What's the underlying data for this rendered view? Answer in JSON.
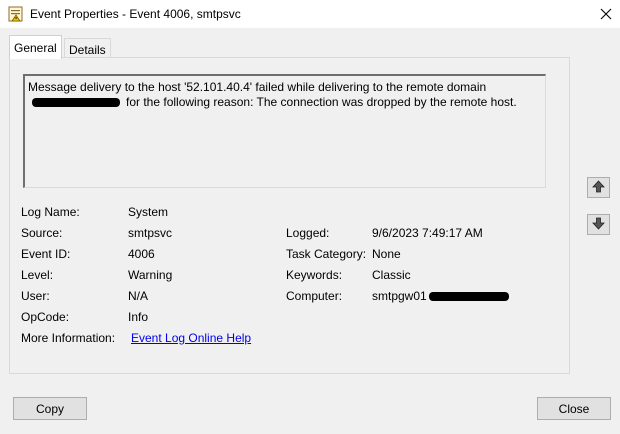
{
  "window": {
    "title": "Event Properties - Event 4006, smtpsvc",
    "icon": "event-viewer-icon",
    "close_icon": "close-icon"
  },
  "tabs": [
    {
      "label": "General",
      "active": true
    },
    {
      "label": "Details",
      "active": false
    }
  ],
  "message": {
    "line1": "Message delivery to the host '52.101.40.4' failed while delivering to the remote domain",
    "line2": "for the following reason: The connection was dropped by the remote host."
  },
  "fields": {
    "log_name": {
      "label": "Log Name:",
      "value": "System"
    },
    "source": {
      "label": "Source:",
      "value": "smtpsvc"
    },
    "event_id": {
      "label": "Event ID:",
      "value": "4006"
    },
    "level": {
      "label": "Level:",
      "value": "Warning"
    },
    "user": {
      "label": "User:",
      "value": "N/A"
    },
    "opcode": {
      "label": "OpCode:",
      "value": "Info"
    },
    "more_info": {
      "label": "More Information:",
      "value": "Event Log Online Help"
    },
    "logged": {
      "label": "Logged:",
      "value": "9/6/2023 7:49:17 AM"
    },
    "task_category": {
      "label": "Task Category:",
      "value": "None"
    },
    "keywords": {
      "label": "Keywords:",
      "value": "Classic"
    },
    "computer": {
      "label": "Computer:",
      "value": "smtpgw01"
    }
  },
  "nav": {
    "up_icon": "arrow-up-icon",
    "down_icon": "arrow-down-icon"
  },
  "buttons": {
    "copy": "Copy",
    "close": "Close"
  }
}
